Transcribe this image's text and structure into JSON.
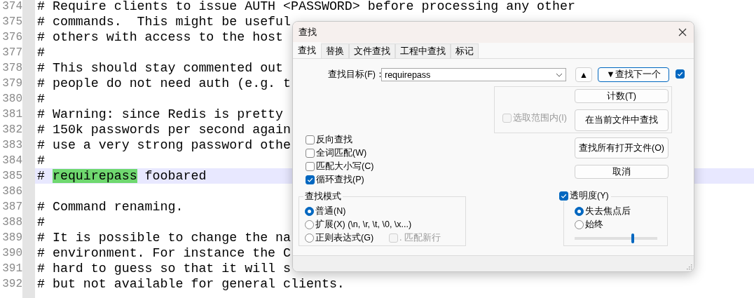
{
  "editor": {
    "lines": [
      {
        "number": "374",
        "current": false,
        "text": "# Require clients to issue AUTH <PASSWORD> before processing any other"
      },
      {
        "number": "375",
        "current": false,
        "text": "# commands.  This might be useful"
      },
      {
        "number": "376",
        "current": false,
        "text": "# others with access to the host"
      },
      {
        "number": "377",
        "current": false,
        "text": "#"
      },
      {
        "number": "378",
        "current": false,
        "text": "# This should stay commented out"
      },
      {
        "number": "379",
        "current": false,
        "text": "# people do not need auth (e.g. t"
      },
      {
        "number": "380",
        "current": false,
        "text": "#"
      },
      {
        "number": "381",
        "current": false,
        "text": "# Warning: since Redis is pretty"
      },
      {
        "number": "382",
        "current": false,
        "text": "# 150k passwords per second again"
      },
      {
        "number": "383",
        "current": false,
        "text": "# use a very strong password othe"
      },
      {
        "number": "384",
        "current": false,
        "text": "#"
      },
      {
        "number": "385",
        "current": true,
        "text": "# ",
        "match": "requirepass",
        "after": " foobared"
      },
      {
        "number": "386",
        "current": false
      },
      {
        "number": "387",
        "current": false,
        "text": "# Command renaming."
      },
      {
        "number": "388",
        "current": false,
        "text": "#"
      },
      {
        "number": "389",
        "current": false,
        "text": "# It is possible to change the na"
      },
      {
        "number": "390",
        "current": false,
        "text": "# environment. For instance the C"
      },
      {
        "number": "391",
        "current": false,
        "text": "# hard to guess so that it will s"
      },
      {
        "number": "392",
        "current": false,
        "text": "# but not available for general clients."
      }
    ]
  },
  "dialog": {
    "title": "查找",
    "tabs": [
      {
        "label": "查找",
        "selected": true
      },
      {
        "label": "替换",
        "selected": false
      },
      {
        "label": "文件查找",
        "selected": false
      },
      {
        "label": "工程中查找",
        "selected": false
      },
      {
        "label": "标记",
        "selected": false
      }
    ],
    "find_label": "查找目标(F)：",
    "find_value": "requirepass",
    "up_button": "▲",
    "next_button": "▼查找下一个",
    "next_checkbox": {
      "checked": true
    },
    "count_button": "计数(T)",
    "in_selection": {
      "label": "选取范围内(I)",
      "checked": false,
      "disabled": true
    },
    "find_in_current_button": "在当前文件中查找",
    "options": [
      {
        "label": "反向查找",
        "checked": false
      },
      {
        "label": "全词匹配(W)",
        "checked": false
      },
      {
        "label": "匹配大小写(C)",
        "checked": false
      },
      {
        "label": "循环查找(P)",
        "checked": true
      }
    ],
    "find_all_open_button": "查找所有打开文件(O)",
    "cancel_button": "取消",
    "search_mode": {
      "title": "查找模式",
      "modes": [
        {
          "label": "普通(N)",
          "selected": true
        },
        {
          "label": "扩展(X) (\\n, \\r, \\t, \\0, \\x...)",
          "selected": false
        },
        {
          "label": "正则表达式(G)",
          "selected": false
        }
      ],
      "dot_newline": {
        "label": ". 匹配新行",
        "checked": false,
        "disabled": true
      }
    },
    "transparency": {
      "label": "透明度(Y)",
      "checked": true,
      "modes": [
        {
          "label": "失去焦点后",
          "selected": true
        },
        {
          "label": "始终",
          "selected": false
        }
      ],
      "level": 0.7
    }
  }
}
